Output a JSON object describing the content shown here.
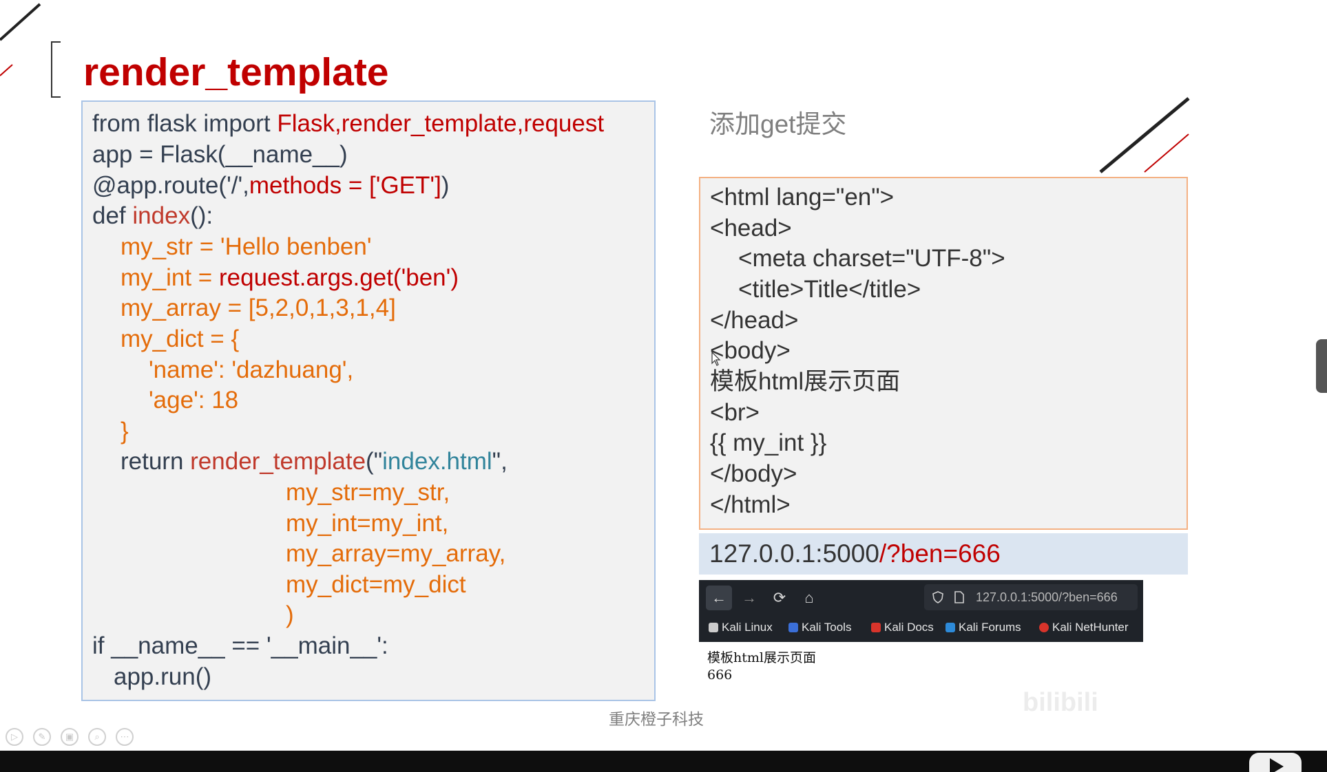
{
  "slide": {
    "title": "render_template",
    "subtitle": "添加get提交",
    "footer": "重庆橙子科技",
    "watermark": "bilibili"
  },
  "code": {
    "l1": {
      "a": "from flask import ",
      "b": "Flask,render_template,request"
    },
    "l2": {
      "a": "app = ",
      "b": "Flask",
      "c": "(__name__)"
    },
    "l3": {
      "a": "@app.route('/',",
      "b": "methods = ['GET']",
      "c": ")"
    },
    "l4": {
      "a": "def ",
      "b": "index",
      "c": "():"
    },
    "l5": "my_str = 'Hello benben'",
    "l6": {
      "a": "my_int = ",
      "b": "request.args.get('ben')"
    },
    "l7": "my_array = [5,2,0,1,3,1,4]",
    "l8": "my_dict = {",
    "l9": "'name': 'dazhuang',",
    "l10": "'age': 18",
    "l11": "}",
    "l12": {
      "a": "return ",
      "b": "render_template",
      "c": "(\"",
      "d": "index.html",
      "e": "\","
    },
    "l13": "my_str=my_str,",
    "l14": "my_int=my_int,",
    "l15": "my_array=my_array,",
    "l16": "my_dict=my_dict",
    "l17": ")",
    "l18": "if __name__ == '__main__':",
    "l19": "app.run()"
  },
  "html_code": {
    "l1": "<html lang=\"en\">",
    "l2": "<head>",
    "l3": "<meta charset=\"UTF-8\">",
    "l4": "<title>Title</title>",
    "l5": "</head>",
    "l6": "<body>",
    "l7": "模板html展示页面",
    "l8": "<br>",
    "l9": "{{ my_int }}",
    "l10": "</body>",
    "l11": "</html>"
  },
  "url": {
    "host": "127.0.0.1:5000",
    "query": "/?ben=666"
  },
  "browser": {
    "address": "127.0.0.1:5000/?ben=666",
    "bookmarks": [
      "Kali Linux",
      "Kali Tools",
      "Kali Docs",
      "Kali Forums",
      "Kali NetHunter"
    ],
    "page_line1": "模板html展示页面",
    "page_line2": "666"
  },
  "colors": {
    "title": "#c00000",
    "code_blue": "#333f50",
    "orange": "#e46c0a",
    "teal": "#31849b"
  }
}
